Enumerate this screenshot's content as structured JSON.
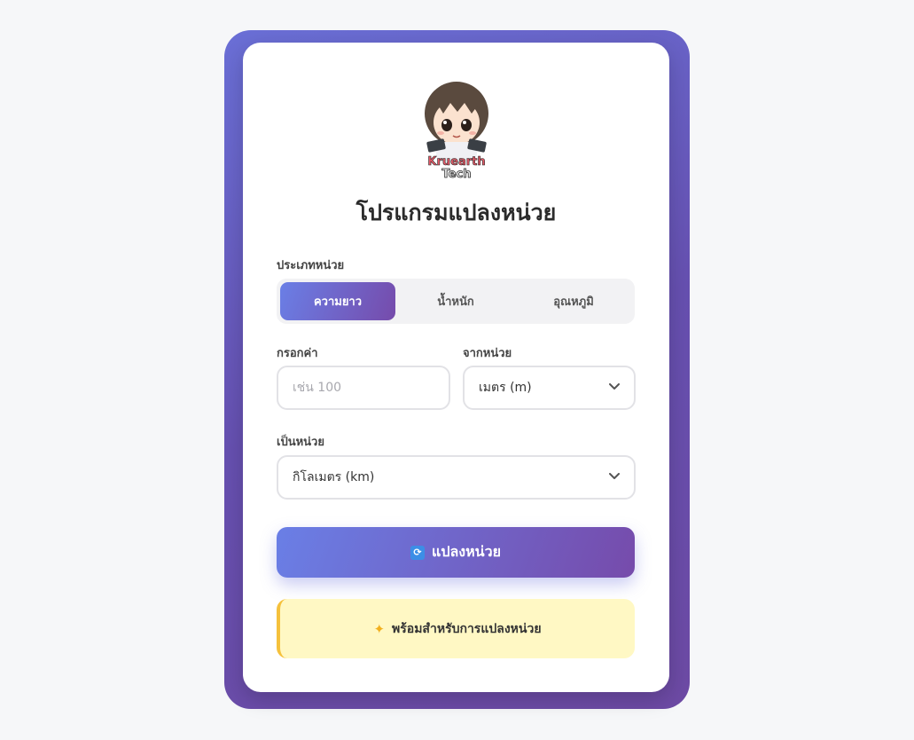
{
  "logo": {
    "line1": "Kruearth",
    "line2": "Tech"
  },
  "title": "โปรแกรมแปลงหน่วย",
  "unit_type": {
    "label": "ประเภทหน่วย",
    "tabs": [
      "ความยาว",
      "น้ำหนัก",
      "อุณหภูมิ"
    ],
    "active_index": 0
  },
  "value_input": {
    "label": "กรอกค่า",
    "placeholder": "เช่น 100",
    "value": ""
  },
  "from_unit": {
    "label": "จากหน่วย",
    "selected": "เมตร (m)"
  },
  "to_unit": {
    "label": "เป็นหน่วย",
    "selected": "กิโลเมตร (km)"
  },
  "convert_button": {
    "icon": "refresh-icon",
    "label": "แปลงหน่วย"
  },
  "status": {
    "icon": "sparkles-icon",
    "text": "พร้อมสำหรับการแปลงหน่วย"
  },
  "colors": {
    "accent_start": "#6a7fe6",
    "accent_end": "#764bab",
    "status_bg": "#fff8c4",
    "status_border": "#f5c13c"
  }
}
